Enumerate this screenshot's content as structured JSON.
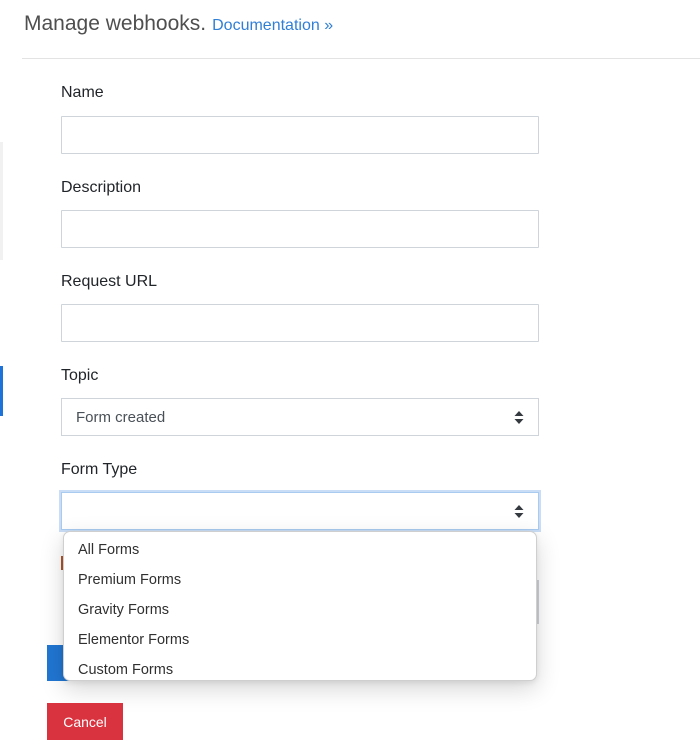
{
  "header": {
    "title": "Manage webhooks.",
    "documentation_link": "Documentation »"
  },
  "form": {
    "name": {
      "label": "Name",
      "value": "",
      "placeholder": ""
    },
    "description": {
      "label": "Description",
      "value": "",
      "placeholder": ""
    },
    "request_url": {
      "label": "Request URL",
      "value": "",
      "placeholder": ""
    },
    "topic": {
      "label": "Topic",
      "selected": "Form created"
    },
    "form_type": {
      "label": "Form Type",
      "selected": "",
      "options": [
        "All Forms",
        "Premium Forms",
        "Gravity Forms",
        "Elementor Forms",
        "Custom Forms"
      ]
    }
  },
  "actions": {
    "cancel_label": "Cancel"
  },
  "colors": {
    "link": "#2f7fd6",
    "cancel": "#d9333f",
    "primary": "#2176d2",
    "focus_ring": "#c9def6"
  },
  "icons": {
    "select_arrow": "updown-caret-icon"
  }
}
